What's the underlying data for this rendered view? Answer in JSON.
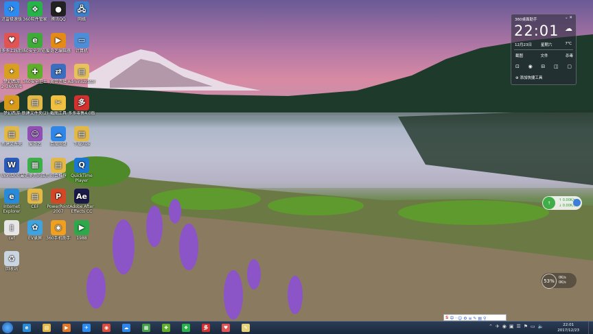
{
  "desktop_icons": [
    {
      "label": "迅雷极速版",
      "icon": "xunlei-icon",
      "color": "#2d8bf0",
      "glyph": "✈"
    },
    {
      "label": "360软件管家",
      "icon": "360-software-icon",
      "color": "#2ab24a",
      "glyph": "❖"
    },
    {
      "label": "腾讯QQ",
      "icon": "qq-penguin-icon",
      "color": "#222222",
      "glyph": "●"
    },
    {
      "label": "网络",
      "icon": "network-icon",
      "color": "#3f7fc9",
      "glyph": "🖧"
    },
    {
      "label": "腾多多上线助手",
      "icon": "helper-icon",
      "color": "#e05454",
      "glyph": "♥"
    },
    {
      "label": "360安全浏览器",
      "icon": "360-browser-icon",
      "color": "#3faa3a",
      "glyph": "e"
    },
    {
      "label": "爱奇艺编辑器",
      "icon": "video-editor-icon",
      "color": "#e48a16",
      "glyph": "▶"
    },
    {
      "label": "计算机",
      "icon": "computer-icon",
      "color": "#4d8dd8",
      "glyph": "▭"
    },
    {
      "label": "梦幻西游2_360游戏",
      "icon": "game-mhxy-icon",
      "color": "#d8a020",
      "glyph": "✦"
    },
    {
      "label": "360安全卫士",
      "icon": "360-safe-icon",
      "color": "#5fae2c",
      "glyph": "✚"
    },
    {
      "label": "宽带连接",
      "icon": "broadband-icon",
      "color": "#3a6fbf",
      "glyph": "⇄"
    },
    {
      "label": "Administrator",
      "icon": "user-folder-icon",
      "color": "#e8c25a",
      "glyph": "▤"
    },
    {
      "label": "梦幻西游",
      "icon": "game-mh-icon",
      "color": "#d89a1a",
      "glyph": "✦"
    },
    {
      "label": "新建文件夹(2)",
      "icon": "folder-icon",
      "color": "#e2b949",
      "glyph": "▤"
    },
    {
      "label": "截图工具",
      "icon": "screenshot-icon",
      "color": "#f0c040",
      "glyph": "✂"
    },
    {
      "label": "多多零售4.0版",
      "icon": "retail-icon",
      "color": "#d33030",
      "glyph": "多"
    },
    {
      "label": "新建文件夹",
      "icon": "folder-icon",
      "color": "#e2b949",
      "glyph": "▤"
    },
    {
      "label": "爱奇艺",
      "icon": "user-icon",
      "color": "#8f4fb3",
      "glyph": "☺"
    },
    {
      "label": "百度网盘",
      "icon": "baidu-netdisk-icon",
      "color": "#2f86e6",
      "glyph": "☁"
    },
    {
      "label": "下载内容",
      "icon": "download-folder-icon",
      "color": "#e2b949",
      "glyph": "▤"
    },
    {
      "label": "Word2007",
      "icon": "word-icon",
      "color": "#2a5bb8",
      "glyph": "W"
    },
    {
      "label": "最近使用的应用",
      "icon": "recent-apps-icon",
      "color": "#3fae49",
      "glyph": "▦"
    },
    {
      "label": "综合推荐",
      "icon": "folder-icon",
      "color": "#e2b949",
      "glyph": "▤"
    },
    {
      "label": "QuickTime Player",
      "icon": "quicktime-icon",
      "color": "#1b76d1",
      "glyph": "Q"
    },
    {
      "label": "Internet Explorer",
      "icon": "ie-icon",
      "color": "#2a8ad8",
      "glyph": "e"
    },
    {
      "label": "CEF",
      "icon": "folder-icon",
      "color": "#e2b949",
      "glyph": "▤"
    },
    {
      "label": "PowerPoint 2007",
      "icon": "powerpoint-icon",
      "color": "#d24726",
      "glyph": "P"
    },
    {
      "label": "Adobe After Effects CC",
      "icon": "after-effects-icon",
      "color": "#1a1a4a",
      "glyph": "Ae"
    },
    {
      "label": "cef",
      "icon": "file-icon",
      "color": "#e6e6e6",
      "glyph": "▯"
    },
    {
      "label": "EV录屏",
      "icon": "ev-recorder-icon",
      "color": "#3fa3e0",
      "glyph": "✿"
    },
    {
      "label": "360手机助手",
      "icon": "360-phone-icon",
      "color": "#f0a020",
      "glyph": "◉"
    },
    {
      "label": "1988",
      "icon": "video-file-icon",
      "color": "#2da84a",
      "glyph": "▶"
    },
    {
      "label": "回收站",
      "icon": "recycle-bin-icon",
      "color": "#c9d6e2",
      "glyph": "♻"
    }
  ],
  "widget": {
    "title": "360桌面助手",
    "controls": "⌄ ✕",
    "time": "22:01",
    "weather_icon": "☁",
    "date": "12月23日",
    "weekday": "星期六",
    "temp": "7℃",
    "btn_screenshot": "截图",
    "btn_files": "文件",
    "btn_more": "杀毒",
    "icons": [
      "⊡",
      "◉",
      "⊟",
      "◫",
      "▢"
    ],
    "add_link": "⊕ 添加快捷工具"
  },
  "netmon": {
    "ball": "↑",
    "up": "↑ 0.00K/s",
    "down": "↓ 0.00K/s"
  },
  "speedball": {
    "pct": "53%",
    "up": "0K/s",
    "down": "0K/s"
  },
  "ime": {
    "logo": "S",
    "text": "中 · ☺ ⚙ ≡ ✎ ▤ ⚲"
  },
  "taskbar": {
    "pinned": [
      {
        "name": "taskbar-ie-icon",
        "glyph": "e",
        "color": "#2a8ad8"
      },
      {
        "name": "taskbar-explorer-icon",
        "glyph": "▤",
        "color": "#e2b949"
      },
      {
        "name": "taskbar-media-icon",
        "glyph": "▶",
        "color": "#e0782a"
      },
      {
        "name": "taskbar-xunlei-icon",
        "glyph": "✈",
        "color": "#2d8bf0"
      },
      {
        "name": "taskbar-chrome-icon",
        "glyph": "◉",
        "color": "#dd4b39"
      },
      {
        "name": "taskbar-baidu-icon",
        "glyph": "☁",
        "color": "#2f86e6"
      },
      {
        "name": "taskbar-apps-icon",
        "glyph": "▦",
        "color": "#43a047"
      },
      {
        "name": "taskbar-360-icon",
        "glyph": "✚",
        "color": "#5fae2c"
      },
      {
        "name": "taskbar-green-icon",
        "glyph": "❖",
        "color": "#2ab24a"
      },
      {
        "name": "taskbar-retail-icon",
        "glyph": "多",
        "color": "#d33030"
      },
      {
        "name": "taskbar-red-icon",
        "glyph": "♥",
        "color": "#e05454"
      },
      {
        "name": "taskbar-notes-icon",
        "glyph": "✎",
        "color": "#e6d27a"
      }
    ],
    "tray": [
      "⌃",
      "✈",
      "◉",
      "▣",
      "☰",
      "⚑",
      "▭",
      "🔈"
    ],
    "time": "22:01",
    "date": "2017/12/23"
  }
}
